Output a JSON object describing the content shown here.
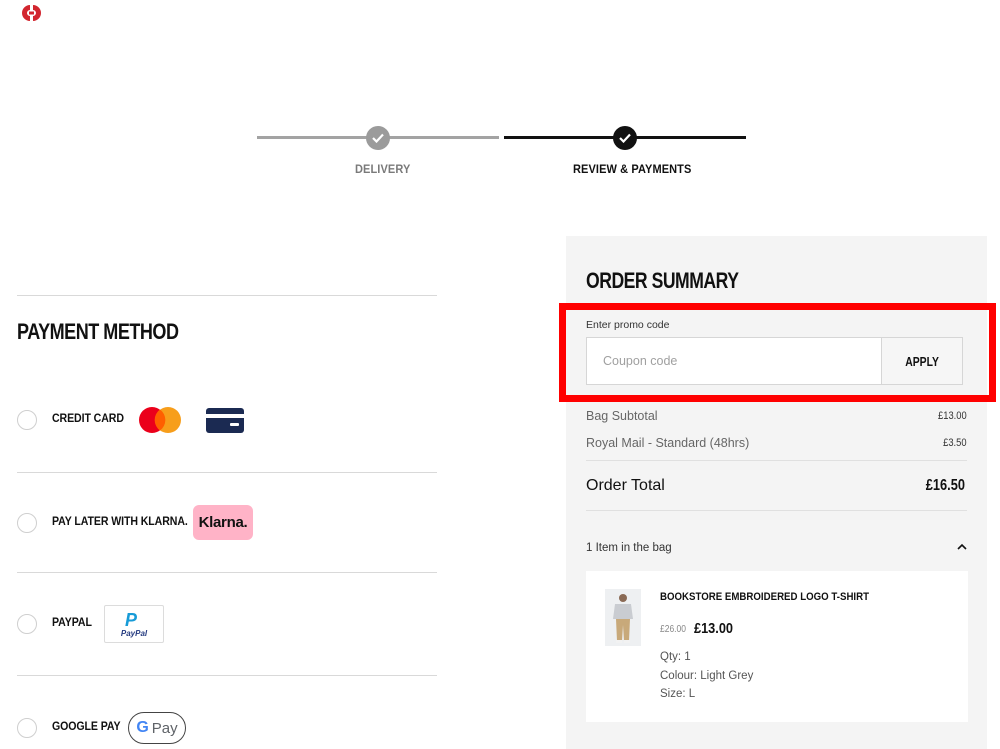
{
  "brand": {
    "logo_icon": "champion-logo-icon",
    "accent": "#d2262f"
  },
  "steps": [
    {
      "label": "DELIVERY",
      "state": "completed-inactive"
    },
    {
      "label": "REVIEW & PAYMENTS",
      "state": "completed-active"
    }
  ],
  "payment": {
    "title": "PAYMENT METHOD",
    "options": [
      {
        "label": "CREDIT CARD",
        "icons": [
          "mastercard-icon",
          "credit-card-icon"
        ]
      },
      {
        "label": "PAY LATER WITH KLARNA.",
        "badge": "Klarna."
      },
      {
        "label": "PAYPAL",
        "badge_top": "P",
        "badge_bottom": "PayPal"
      },
      {
        "label": "GOOGLE PAY",
        "badge_g": "G",
        "badge_pay": "Pay"
      }
    ]
  },
  "summary": {
    "title": "ORDER SUMMARY",
    "promo": {
      "label": "Enter promo code",
      "placeholder": "Coupon code",
      "value": "",
      "apply_label": "APPLY"
    },
    "lines": [
      {
        "label": "Bag Subtotal",
        "value": "£13.00"
      },
      {
        "label": "Royal Mail - Standard (48hrs)",
        "value": "£3.50"
      }
    ],
    "total": {
      "label": "Order Total",
      "value": "£16.50"
    },
    "bag_count": "1 Item in the bag",
    "item": {
      "name": "BOOKSTORE EMBROIDERED LOGO T-SHIRT",
      "price_old": "£26.00",
      "price_new": "£13.00",
      "qty": "Qty: 1",
      "colour": "Colour: Light Grey",
      "size": "Size: L"
    }
  }
}
